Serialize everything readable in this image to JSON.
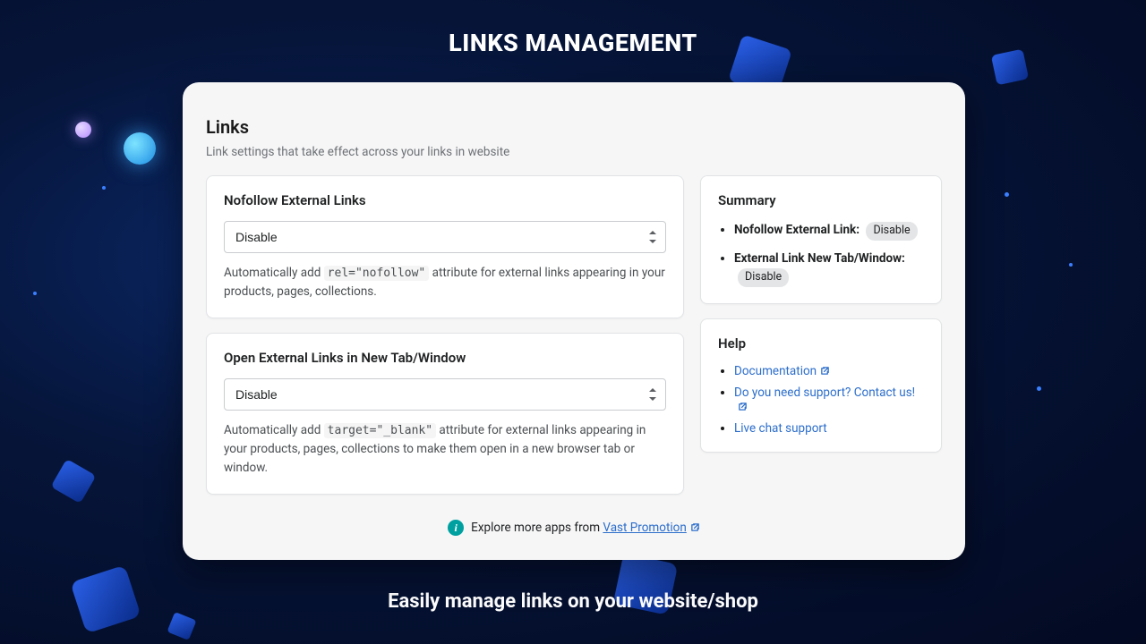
{
  "hero": {
    "title": "LINKS MANAGEMENT",
    "subtitle": "Easily manage links on your website/shop"
  },
  "panel": {
    "title": "Links",
    "description": "Link settings that take effect across your links in website"
  },
  "cards": {
    "nofollow": {
      "title": "Nofollow External Links",
      "value": "Disable",
      "help_pre": "Automatically add ",
      "help_code": "rel=\"nofollow\"",
      "help_post": " attribute for external links appearing in your products, pages, collections."
    },
    "newtab": {
      "title": "Open External Links in New Tab/Window",
      "value": "Disable",
      "help_pre": "Automatically add ",
      "help_code": "target=\"_blank\"",
      "help_post": " attribute for external links appearing in your products, pages, collections to make them open in a new browser tab or window."
    }
  },
  "summary": {
    "title": "Summary",
    "items": [
      {
        "label": "Nofollow External Link:",
        "badge": "Disable"
      },
      {
        "label": "External Link New Tab/Window:",
        "badge": "Disable"
      }
    ]
  },
  "help": {
    "title": "Help",
    "links": [
      {
        "label": "Documentation",
        "external": true
      },
      {
        "label": "Do you need support? Contact us!",
        "external": true
      },
      {
        "label": "Live chat support",
        "external": false
      }
    ]
  },
  "footer": {
    "text": "Explore more apps from ",
    "link": "Vast Promotion"
  }
}
